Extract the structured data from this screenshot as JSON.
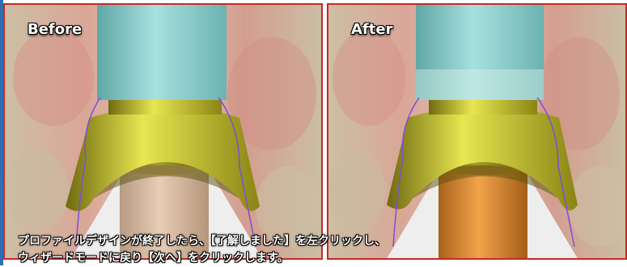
{
  "panels": {
    "before": {
      "label": "Before"
    },
    "after": {
      "label": "After"
    }
  },
  "caption": {
    "line1": "プロファイルデザインが終了したら、【了解しました】を左クリックし、",
    "line2": "ウィザードモードに戻り【次へ】をクリックします。"
  },
  "colors": {
    "panel_border": "#c62828",
    "left_strip": "#2f6fb0",
    "abutment_cap": "#8fd0cf",
    "crown_yellow": "#d8d640",
    "implant_before": "#d6b59a",
    "implant_after": "#d98a2e",
    "margin_line": "#7a4fd6"
  }
}
